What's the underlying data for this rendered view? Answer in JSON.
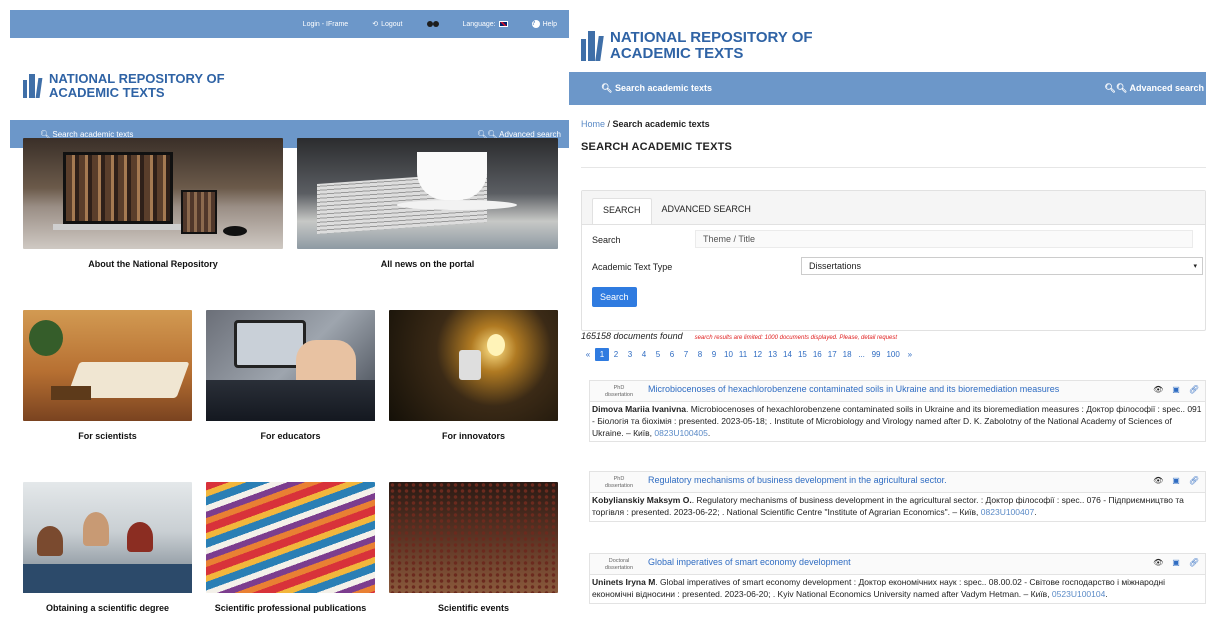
{
  "left": {
    "topbar": {
      "login": "Login - IFrame",
      "logout": "Logout",
      "language": "Language:",
      "help": "Help"
    },
    "logo": {
      "line1": "NATIONAL REPOSITORY OF",
      "line2": "ACADEMIC TEXTS"
    },
    "search_link": "Search academic texts",
    "advanced_link": "Advanced search",
    "tiles": [
      {
        "caption": "About the National Repository"
      },
      {
        "caption": "All news on the portal"
      },
      {
        "caption": "For scientists"
      },
      {
        "caption": "For educators"
      },
      {
        "caption": "For innovators"
      },
      {
        "caption": "Obtaining a scientific degree"
      },
      {
        "caption": "Scientific professional publications"
      },
      {
        "caption": "Scientific events"
      }
    ]
  },
  "right": {
    "logo": {
      "line1": "NATIONAL REPOSITORY OF",
      "line2": "ACADEMIC TEXTS"
    },
    "search_link": "Search academic texts",
    "advanced_link": "Advanced search",
    "breadcrumb": {
      "home": "Home",
      "sep": " / ",
      "current": "Search academic texts"
    },
    "title": "SEARCH ACADEMIC TEXTS",
    "tabs": [
      "SEARCH",
      "ADVANCED SEARCH"
    ],
    "form": {
      "search_label": "Search",
      "search_placeholder": "Theme / Title",
      "type_label": "Academic Text Type",
      "type_value": "Dissertations",
      "button": "Search"
    },
    "found": "165158 documents found",
    "warning": "search results are limited: 1000 documents displayed. Please, detail request",
    "pager": [
      "«",
      "1",
      "2",
      "3",
      "4",
      "5",
      "6",
      "7",
      "8",
      "9",
      "10",
      "11",
      "12",
      "13",
      "14",
      "15",
      "16",
      "17",
      "18",
      "...",
      "99",
      "100",
      "»"
    ],
    "results": [
      {
        "type_line1": "PhD",
        "type_line2": "dissertation",
        "title": "Microbiocenoses of hexachlorobenzene contaminated soils in Ukraine and its bioremediation measures",
        "author": "Dimova Mariia Ivanivna",
        "text": ". Microbiocenoses of hexachlorobenzene contaminated soils in Ukraine and its bioremediation measures : Доктор філософії : spec.. 091 - Біологія та біохімія : presented. 2023-05-18; . Institute of Microbiology and Virology named after D. K. Zabolotny of the National Academy of Sciences of Ukraine. – Київ, ",
        "code": "0823U100405",
        "tail": "."
      },
      {
        "type_line1": "PhD",
        "type_line2": "dissertation",
        "title": "Regulatory mechanisms of business development in the agricultural sector.",
        "author": "Kobylianskiy Maksym O.",
        "text": ". Regulatory mechanisms of business development in the agricultural sector. : Доктор філософії : spec.. 076 - Підприємництво та торгівля : presented. 2023-06-22; . National Scientific Centre \"Institute of Agrarian Economics\". – Київ, ",
        "code": "0823U100407",
        "tail": "."
      },
      {
        "type_line1": "Doctoral",
        "type_line2": "dissertation",
        "title": "Global imperatives of smart economy development",
        "author": "Uninets Iryna M",
        "text": ". Global imperatives of smart economy development : Доктор економічних наук : spec.. 08.00.02 - Світове господарство і міжнародні економічні відносини : presented. 2023-06-20; . Kyiv National Economics University named after Vadym Hetman. – Київ, ",
        "code": "0523U100104",
        "tail": "."
      }
    ],
    "icons": [
      "eye-icon",
      "card-icon",
      "link-icon"
    ]
  }
}
